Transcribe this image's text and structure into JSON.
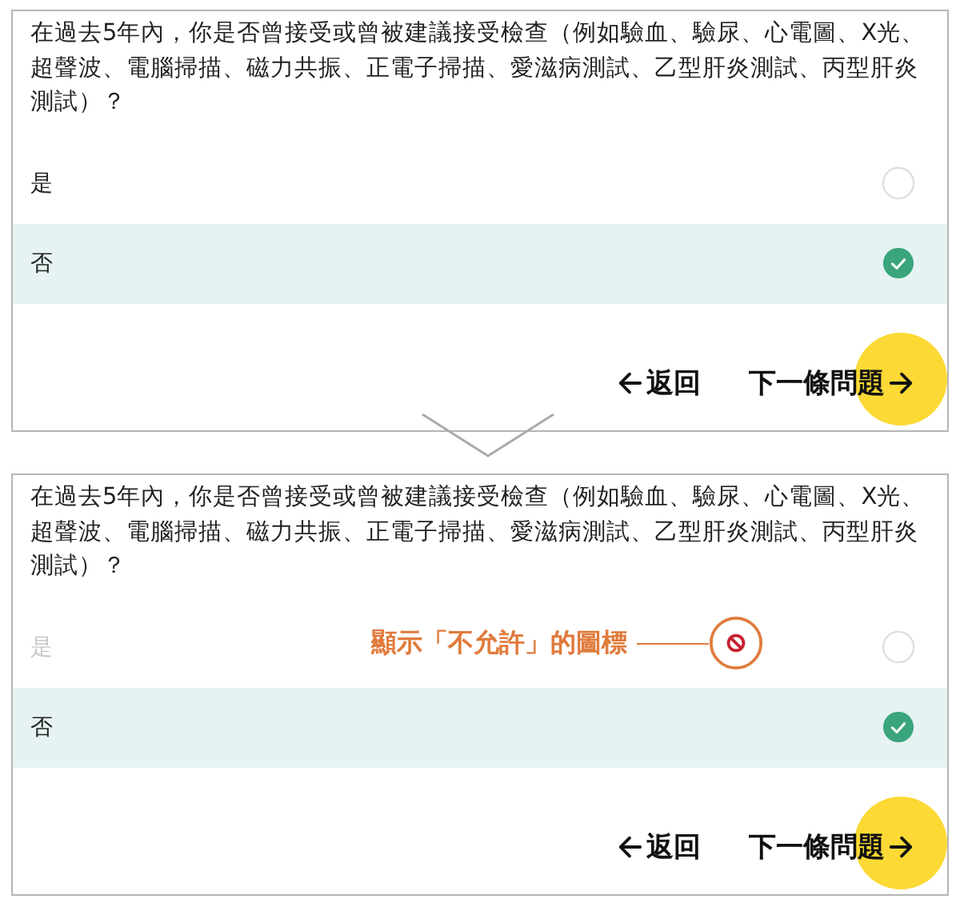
{
  "panels": [
    {
      "question": "在過去5年內，你是否曾接受或曾被建議接受檢查（例如驗血、驗尿、心電圖、X光、超聲波、電腦掃描、磁力共振、正電子掃描、愛滋病測試、乙型肝炎測試、丙型肝炎測試）？",
      "options": [
        {
          "label": "是",
          "selected": false,
          "disabled": false
        },
        {
          "label": "否",
          "selected": true,
          "disabled": false
        }
      ],
      "back": "返回",
      "next": "下一條問題"
    },
    {
      "question": "在過去5年內，你是否曾接受或曾被建議接受檢查（例如驗血、驗尿、心電圖、X光、超聲波、電腦掃描、磁力共振、正電子掃描、愛滋病測試、乙型肝炎測試、丙型肝炎測試）？",
      "options": [
        {
          "label": "是",
          "selected": false,
          "disabled": true
        },
        {
          "label": "否",
          "selected": true,
          "disabled": false
        }
      ],
      "back": "返回",
      "next": "下一條問題",
      "annotation": "顯示「不允許」的圖標"
    }
  ]
}
